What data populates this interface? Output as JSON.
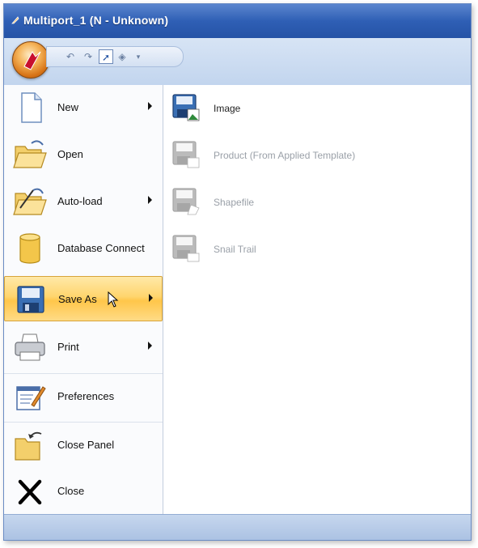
{
  "window": {
    "title": "Multiport_1 (N - Unknown)"
  },
  "menu": {
    "items": [
      {
        "label": "New",
        "icon": "new-document-icon",
        "submenu": true
      },
      {
        "label": "Open",
        "icon": "open-folder-icon",
        "submenu": false
      },
      {
        "label": "Auto-load",
        "icon": "auto-load-folder-icon",
        "submenu": true
      },
      {
        "label": "Database Connect",
        "icon": "database-icon",
        "submenu": false
      },
      {
        "label": "Save As",
        "icon": "save-icon",
        "submenu": true,
        "active": true
      },
      {
        "label": "Print",
        "icon": "printer-icon",
        "submenu": true
      },
      {
        "label": "Preferences",
        "icon": "preferences-icon",
        "submenu": false
      },
      {
        "label": "Close Panel",
        "icon": "close-panel-icon",
        "submenu": false
      },
      {
        "label": "Close",
        "icon": "close-icon",
        "submenu": false
      }
    ]
  },
  "submenu": {
    "items": [
      {
        "label": "Image",
        "icon": "save-image-icon",
        "enabled": true
      },
      {
        "label": "Product (From Applied Template)",
        "icon": "save-product-icon",
        "enabled": false
      },
      {
        "label": "Shapefile",
        "icon": "save-shapefile-icon",
        "enabled": false
      },
      {
        "label": "Snail Trail",
        "icon": "save-snail-trail-icon",
        "enabled": false
      }
    ]
  },
  "colors": {
    "titlebar": "#2f5fb5",
    "highlight": "#ffd56e",
    "disabled_text": "#9aa0a8"
  }
}
